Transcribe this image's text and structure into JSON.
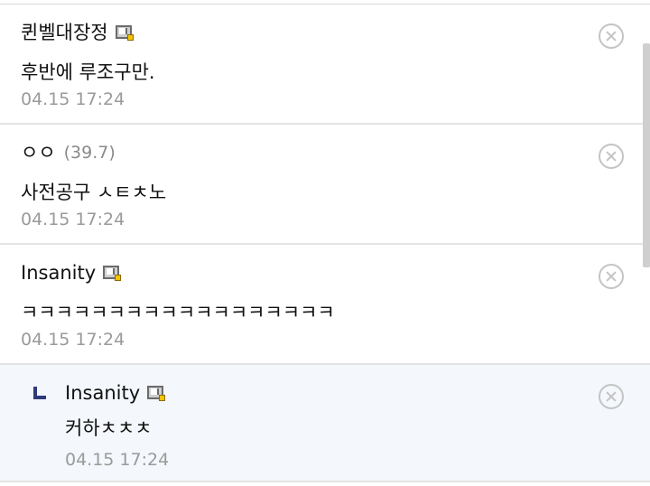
{
  "comments": [
    {
      "author": "퀸벨대장정",
      "ip": "",
      "has_badge": true,
      "text": "후반에 루조구만.",
      "time": "04.15 17:24"
    },
    {
      "author": "ㅇㅇ",
      "ip": "(39.7)",
      "has_badge": false,
      "text": "사전공구 ㅅㅌㅊ노",
      "time": "04.15 17:24"
    },
    {
      "author": "Insanity",
      "ip": "",
      "has_badge": true,
      "text": "ㅋㅋㅋㅋㅋㅋㅋㅋㅋㅋㅋㅋㅋㅋㅋㅋㅋㅋ",
      "time": "04.15 17:24"
    }
  ],
  "reply": {
    "author": "Insanity",
    "has_badge": true,
    "text": "커하ㅊㅊㅊ",
    "time": "04.15 17:24"
  },
  "icons": {
    "badge": "gallery-member-badge-icon",
    "delete": "delete-circle-x-icon",
    "reply": "reply-arrow-icon"
  },
  "colors": {
    "reply_background": "#f4f7fb",
    "reply_icon": "#2e3b78",
    "timestamp": "#9a9a9a",
    "badge_dot": "#f3c400"
  }
}
